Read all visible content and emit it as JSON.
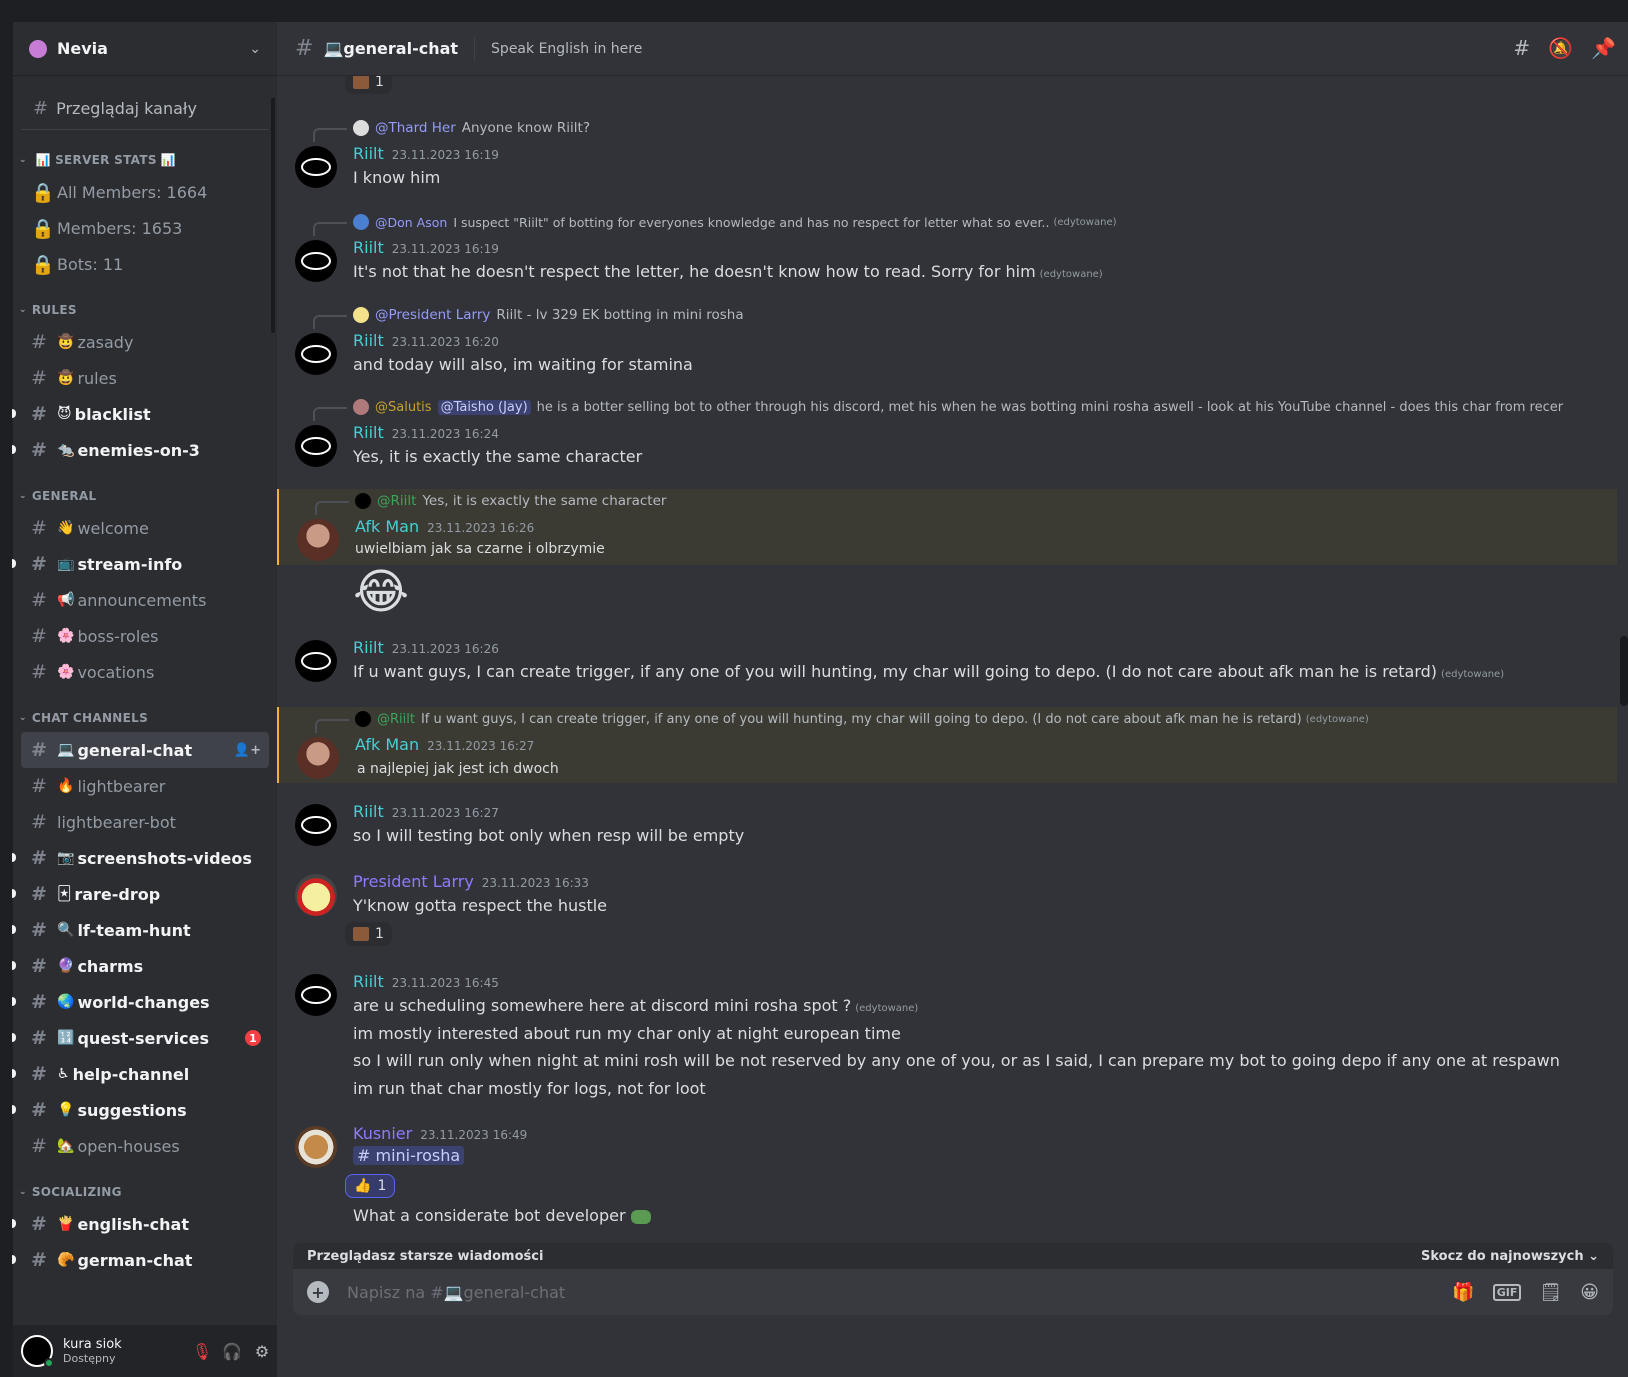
{
  "server": {
    "name": "Nevia"
  },
  "browse_label": "Przeglądaj kanały",
  "categories": {
    "stats": "SERVER STATS",
    "rules": "RULES",
    "general": "GENERAL",
    "chat": "CHAT CHANNELS",
    "social": "SOCIALIZING"
  },
  "stats": [
    "All Members: 1664",
    "Members: 1653",
    "Bots: 11"
  ],
  "rules_channels": [
    {
      "name": "zasady",
      "emoji": "🤠",
      "unread": false
    },
    {
      "name": "rules",
      "emoji": "🤠",
      "unread": false
    },
    {
      "name": "blacklist",
      "emoji": "😈",
      "unread": true
    },
    {
      "name": "enemies-on-3",
      "emoji": "🐀",
      "unread": true
    }
  ],
  "general_channels": [
    {
      "name": "welcome",
      "emoji": "👋",
      "unread": false
    },
    {
      "name": "stream-info",
      "emoji": "📺",
      "unread": true
    },
    {
      "name": "announcements",
      "emoji": "📢",
      "unread": false
    },
    {
      "name": "boss-roles",
      "emoji": "🌸",
      "unread": false
    },
    {
      "name": "vocations",
      "emoji": "🌸",
      "unread": false
    }
  ],
  "chat_channels": [
    {
      "name": "general-chat",
      "emoji": "💻"
    },
    {
      "name": "lightbearer",
      "emoji": "🔥"
    },
    {
      "name": "lightbearer-bot",
      "emoji": ""
    },
    {
      "name": "screenshots-videos",
      "emoji": "📷"
    },
    {
      "name": "rare-drop",
      "emoji": "🃏"
    },
    {
      "name": "lf-team-hunt",
      "emoji": "🔍"
    },
    {
      "name": "charms",
      "emoji": "🔮"
    },
    {
      "name": "world-changes",
      "emoji": "🌏"
    },
    {
      "name": "quest-services",
      "emoji": "🔢",
      "badge": "1"
    },
    {
      "name": "help-channel",
      "emoji": "♿"
    },
    {
      "name": "suggestions",
      "emoji": "💡"
    },
    {
      "name": "open-houses",
      "emoji": "🏡"
    }
  ],
  "social_channels": [
    {
      "name": "english-chat",
      "emoji": "🍟"
    },
    {
      "name": "german-chat",
      "emoji": "🥐"
    }
  ],
  "user": {
    "name": "kura siok",
    "status": "Dostępny"
  },
  "header": {
    "channel": "💻general-chat",
    "topic": "Speak English in here"
  },
  "messages": {
    "top_reaction_count": "1",
    "m1": {
      "reply_mention": "@Thard Her",
      "reply_text": "Anyone know Riilt?",
      "author": "Riilt",
      "time": "23.11.2023 16:19",
      "text": "I know him"
    },
    "m2": {
      "reply_mention": "@Don Ason",
      "reply_text": "I suspect \"Riilt\" of botting for everyones knowledge and has no respect for letter what so ever..",
      "reply_edited": "(edytowane)",
      "author": "Riilt",
      "time": "23.11.2023 16:19",
      "text": "It's not that he doesn't respect the letter, he doesn't know how to read. Sorry for him",
      "edited": "(edytowane)"
    },
    "m3": {
      "reply_mention": "@President Larry",
      "reply_text": "Riilt - lv 329 EK botting in mini rosha",
      "author": "Riilt",
      "time": "23.11.2023 16:20",
      "text": "and today will also, im waiting for stamina"
    },
    "m4": {
      "reply_mention": "@Salutis",
      "reply_pill": "@Taisho (Jay)",
      "reply_text": "he is a botter selling bot to other through his discord, met his when he was botting mini rosha aswell - look at his YouTube channel - does this char from recer",
      "author": "Riilt",
      "time": "23.11.2023 16:24",
      "text": "Yes, it is exactly the same character"
    },
    "m5": {
      "reply_mention": "@Riilt",
      "reply_text": "Yes, it is exactly the same character",
      "author": "Afk Man",
      "time": "23.11.2023 16:26",
      "text": "uwielbiam jak sa czarne i olbrzymie",
      "emoji": "😂"
    },
    "m6": {
      "author": "Riilt",
      "time": "23.11.2023 16:26",
      "text": "If u want guys, I can create trigger, if any one of you will hunting, my char will going to depo. (I do not care about afk man he is retard)",
      "edited": "(edytowane)"
    },
    "m7": {
      "reply_mention": "@Riilt",
      "reply_text": "If u want guys, I can create trigger, if any one of you will hunting, my char will going to depo. (I do not care about afk man he is retard)",
      "reply_edited": "(edytowane)",
      "author": "Afk Man",
      "time": "23.11.2023 16:27",
      "text": "a najlepiej jak jest ich dwoch"
    },
    "m8": {
      "author": "Riilt",
      "time": "23.11.2023 16:27",
      "text": "so I will testing bot only when resp will be empty"
    },
    "m9": {
      "author": "President Larry",
      "time": "23.11.2023 16:33",
      "text": "Y'know gotta respect the hustle",
      "reaction_count": "1"
    },
    "m10": {
      "author": "Riilt",
      "time": "23.11.2023 16:45",
      "lines": [
        "are u scheduling somewhere here at discord mini rosha spot ?",
        "im mostly interested about run my char only at night european time",
        "so I will run only when night at mini rosh will be not reserved by any one of you, or as I said, I can prepare my bot to going depo if any one at respawn",
        "im run that char mostly for logs, not for loot"
      ],
      "edited": "(edytowane)"
    },
    "m11": {
      "author": "Kusnier",
      "time": "23.11.2023 16:49",
      "channel_mention": "# mini-rosha",
      "reaction_emoji": "👍",
      "reaction_count": "1",
      "text": "What a considerate bot developer"
    }
  },
  "older_bar": {
    "label": "Przeglądasz starsze wiadomości",
    "jump": "Skocz do najnowszych"
  },
  "composer": {
    "placeholder": "Napisz na #💻general-chat"
  }
}
